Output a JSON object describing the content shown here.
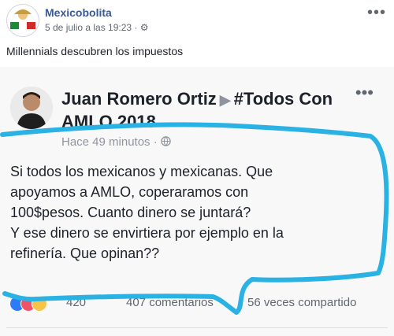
{
  "post": {
    "page_name": "Mexicobolita",
    "date_text": "5 de julio a las 19:23",
    "privacy_icon": "gear-icon",
    "text": "Millennials descubren los impuestos"
  },
  "shared_post": {
    "author": "Juan Romero Ortiz",
    "target": "#Todos Con AMLO 2018",
    "time": "Hace 49 minutos",
    "privacy_icon": "globe-icon",
    "lines": [
      "Si todos los mexicanos y mexicanas. Que",
      "apoyamos a AMLO, coperaramos con",
      "100$pesos. Cuanto dinero se juntará?",
      "Y ese dinero se envirtiera por ejemplo en la",
      "refinería. Que opinan??"
    ],
    "reactions_count": "420",
    "comments": "407 comentarios",
    "shares": "5​6 veces compartido"
  },
  "colors": {
    "link_blue": "#385898",
    "annotation_cyan": "#2bb2e4"
  }
}
